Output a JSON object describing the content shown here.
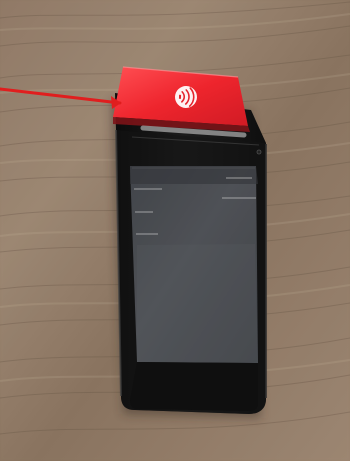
{
  "scene": {
    "background": "wood",
    "device_color": "#111111",
    "nfc_panel_color": "#ef1c27",
    "arrow_color": "#e01818",
    "icon": "nfc-icon"
  },
  "device": {
    "brand": "",
    "header_label": "",
    "text_lines": [
      "",
      "",
      "",
      "",
      ""
    ]
  }
}
